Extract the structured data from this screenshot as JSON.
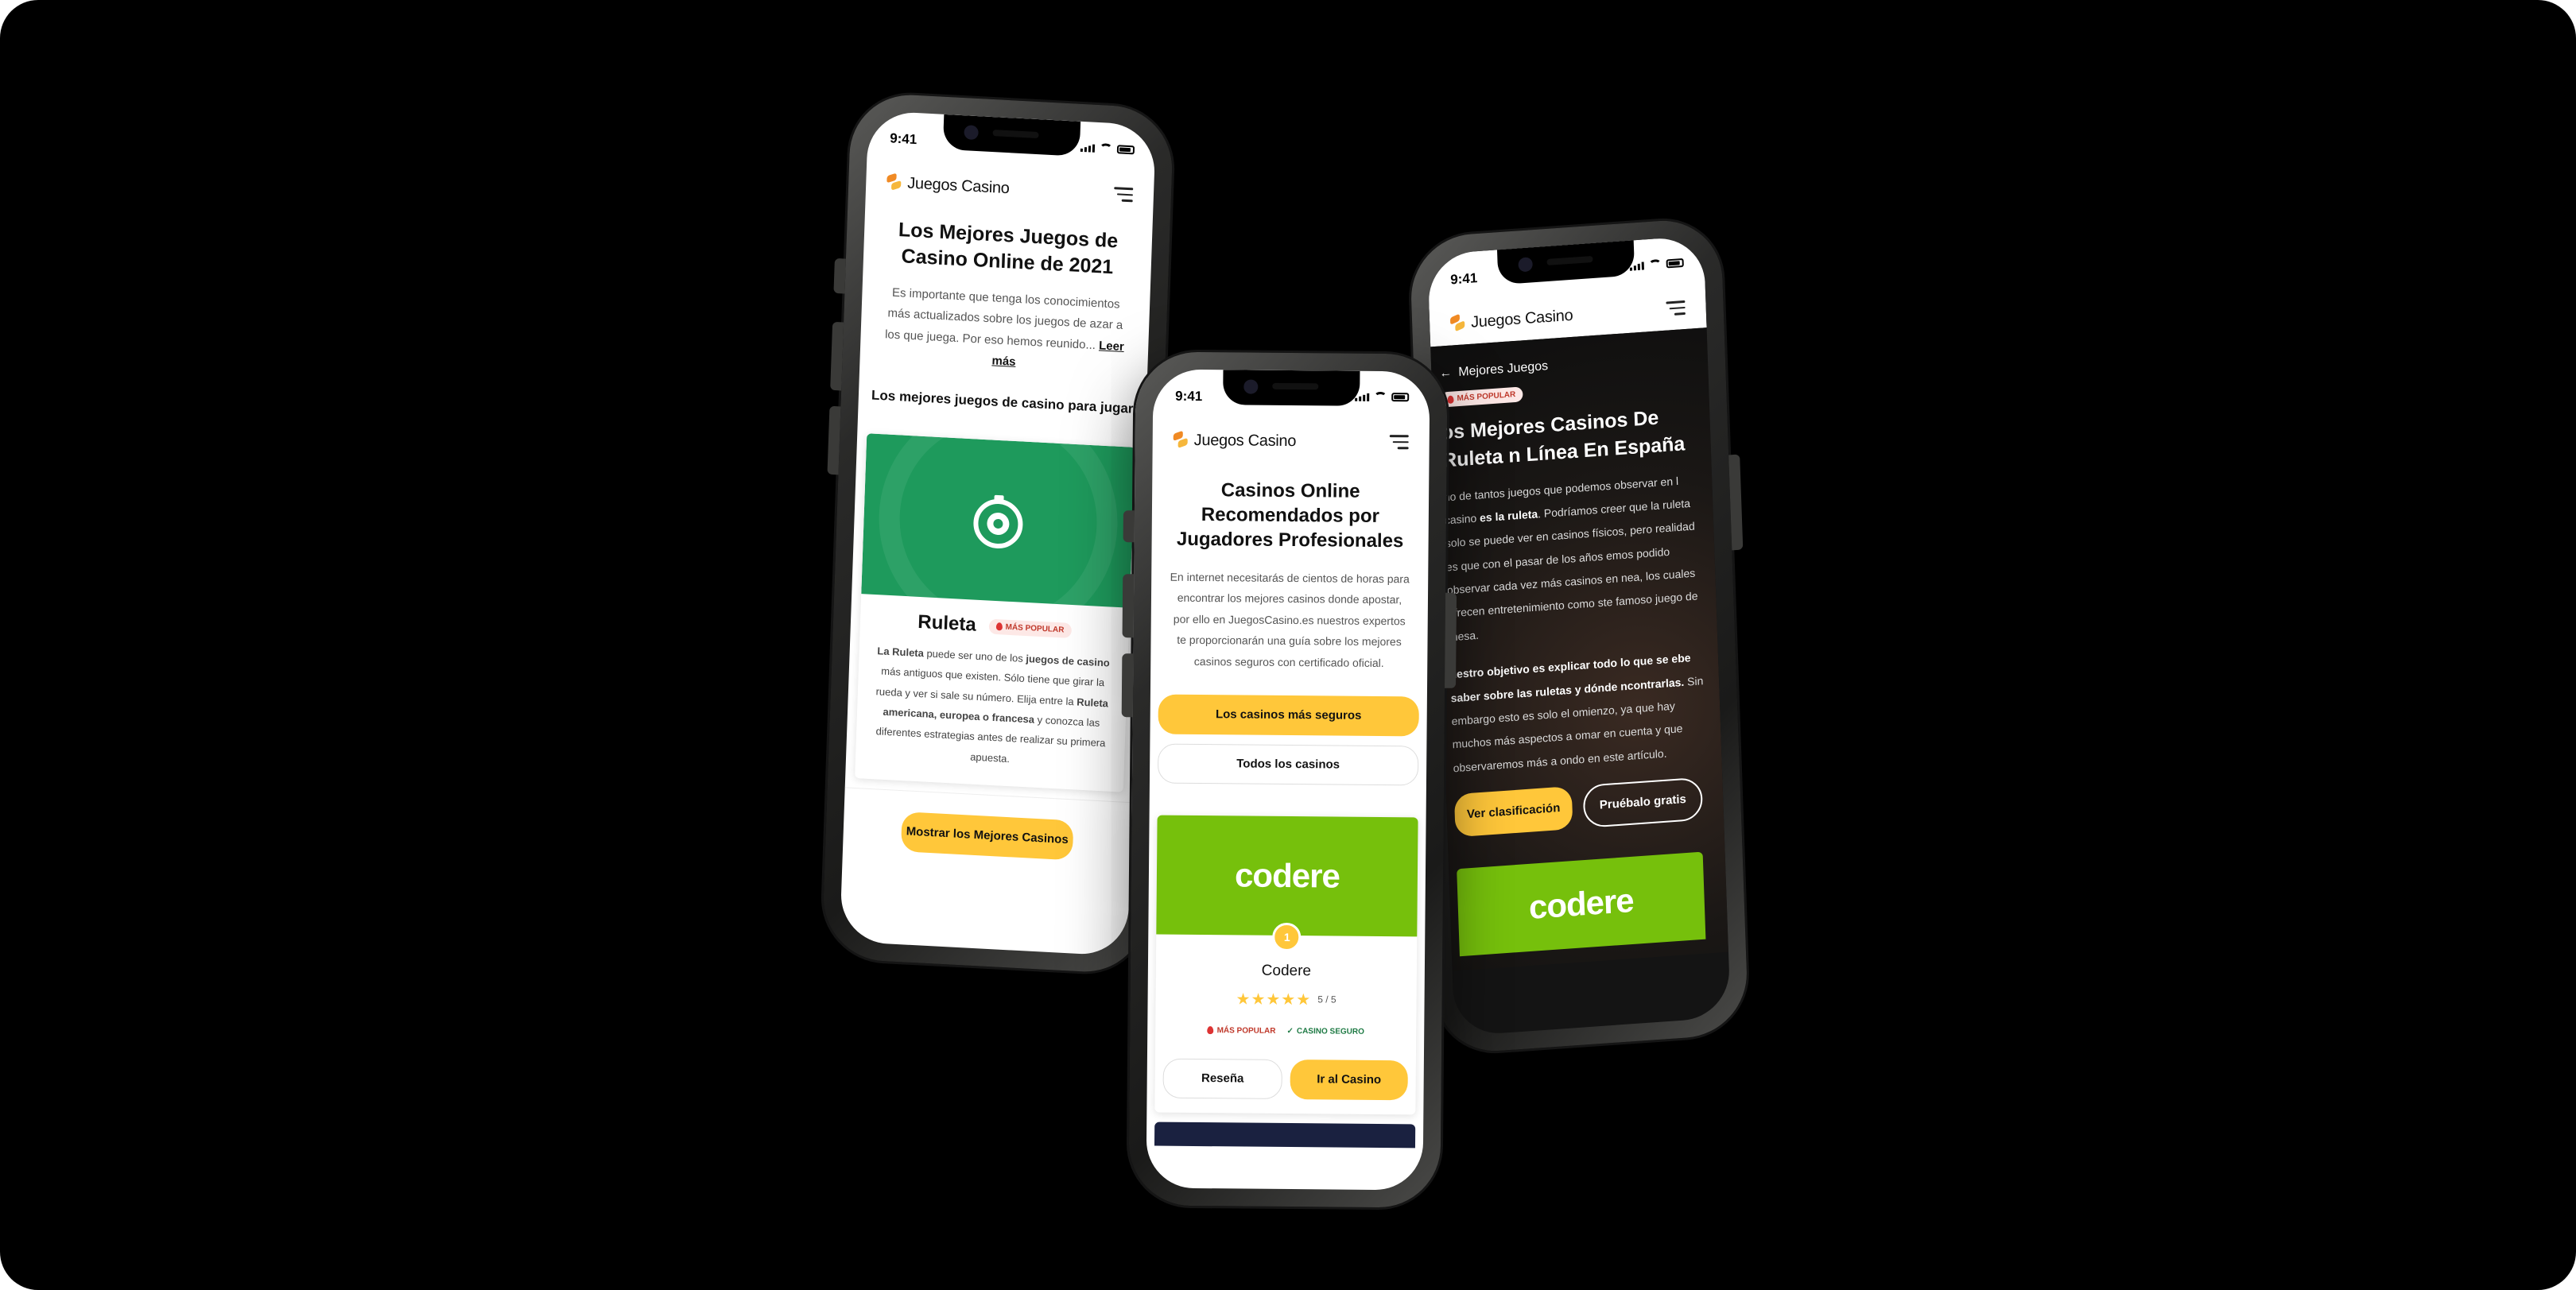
{
  "brand": {
    "name": "Juegos Casino"
  },
  "status": {
    "time": "9:41"
  },
  "colors": {
    "accent_yellow": "#ffc73a",
    "roulette_green": "#1e9a5c",
    "codere_green": "#76c00c",
    "dark_bg": "#141414",
    "popular_red": "#c0392b"
  },
  "phone_left": {
    "title": "Los Mejores Juegos de Casino Online de 2021",
    "intro": "Es importante que tenga los conocimientos más actualizados sobre los juegos de azar a los que juega. Por eso hemos reunido...",
    "read_more": "Leer más",
    "section_title": "Los mejores juegos de casino para jugar",
    "game": {
      "icon": "roulette-icon",
      "name": "Ruleta",
      "badge": "MÁS POPULAR",
      "desc_1": "La Ruleta",
      "desc_2": " puede ser uno de los ",
      "desc_3": "juegos de casino",
      "desc_4": " más antiguos que existen. Sólo tiene que girar la rueda y ver si sale su número. Elija entre la ",
      "desc_5": "Ruleta americana, europea o francesa",
      "desc_6": " y conozca las diferentes estrategias antes de realizar su primera apuesta."
    },
    "cta": "Mostrar los Mejores Casinos"
  },
  "phone_middle": {
    "title": "Casinos Online Recomendados por Jugadores Profesionales",
    "intro": "En internet necesitarás de cientos de horas para encontrar los mejores casinos donde apostar, por ello en JuegosCasino.es nuestros expertos te proporcionarán una guía sobre los mejores casinos seguros con certificado oficial.",
    "btn_safe": "Los casinos más seguros",
    "btn_all": "Todos los casinos",
    "casino": {
      "logo": "codere",
      "rank": "1",
      "name": "Codere",
      "stars": "★★★★★",
      "rating": "5 / 5",
      "badge_popular": "MÁS POPULAR",
      "badge_safe": "CASINO SEGURO"
    },
    "btn_review": "Reseña",
    "btn_go": "Ir al Casino"
  },
  "phone_right": {
    "back": "Mejores Juegos",
    "badge": "MÁS POPULAR",
    "title": "os Mejores Casinos De Ruleta n Línea En España",
    "p1_a": "no de tantos juegos que podemos observar en l casino ",
    "p1_b": "es la ruleta",
    "p1_c": ". Podríamos creer que la ruleta solo se puede ver en casinos físicos, pero realidad es que con el pasar de los años emos podido observar cada vez más casinos en nea, los cuales ofrecen entretenimiento como ste famoso juego de mesa.",
    "p2_a": "uestro objetivo es explicar todo lo que se ebe saber sobre las ruletas y dónde ncontrarlas.",
    "p2_b": " Sin embargo esto es solo el omienzo, ya que hay muchos más aspectos a omar en cuenta y que observaremos más a ondo en este artículo.",
    "btn_rank": "Ver clasificación",
    "btn_free": "Pruébalo gratis",
    "casino_logo": "codere"
  }
}
